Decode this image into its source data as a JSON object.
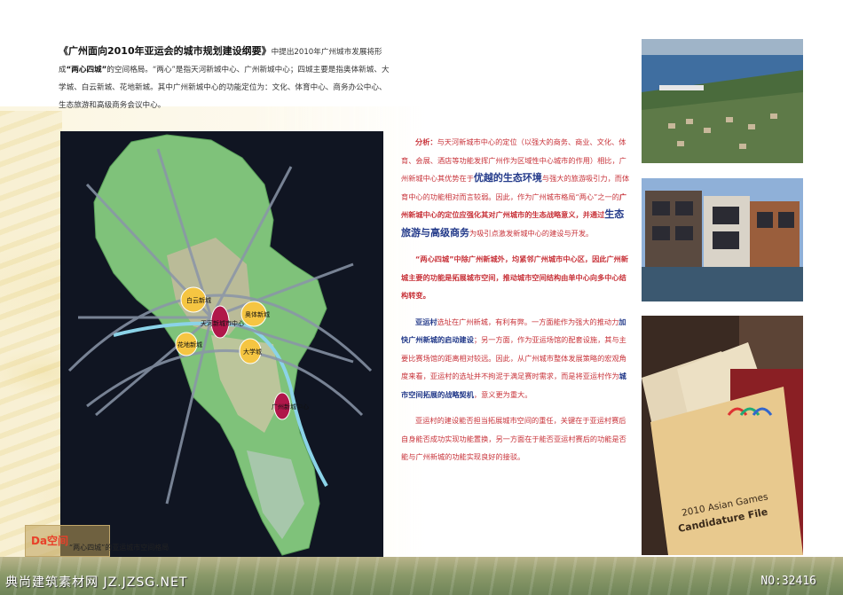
{
  "intro": {
    "title": "《广州面向2010年亚运会的城市规划建设纲要》",
    "text1": "中提出2010年广州城市发展将形成",
    "em1": "“两心四城”",
    "text2": "的空间格局。“两心”是指天河新城中心、广州新城中心；四城主要是指奥体新城、大学城、白云新城、花地新城。其中广州新城中心的功能定位为：文化、体育中心、商务办公中心、生态旅游和高级商务会议中心。"
  },
  "map": {
    "labels": {
      "baiyun": "白云新城",
      "aoti": "奥体新城",
      "tianhe": "天河新城市中心",
      "huadi": "花地新城",
      "daxue": "大学城",
      "guangzhou": "广州新城中心"
    },
    "caption": "“两心四城”的亚运城市空间格局",
    "logo": "Da空间"
  },
  "analysis": {
    "p1_label": "分析：",
    "p1_a": "与天河新城市中心的定位（以强大的商务、商业、文化、体育、会展、酒店等功能发挥广州作为区域性中心城市的作用）相比，广州新城中心其优势在于",
    "p1_big1": "优越的生态环境",
    "p1_b": "与强大的旅游吸引力，而体育中心的功能相对而言较弱。因此，作为广州城市格局“两心”之一的",
    "p1_bold": "广州新城中心的定位应强化其对广州城市的生态战略意义，并通过",
    "p1_big2": "生态旅游与高级商务",
    "p1_c": "为吸引点激发新城中心的建设与开发。",
    "p2": "“两心四城”中除广州新城外，均紧邻广州城市中心区，因此广州新城主要的功能是拓展城市空间，推动城市空间结构由单中心向多中心结构转变。",
    "p3_blue": "亚运村",
    "p3_a": "选址在广州新城，有利有弊。一方面能作为强大的推动力",
    "p3_blue2": "加快广州新城的启动建设",
    "p3_b": "；另一方面，作为亚运场馆的配套设施，其与主要比赛场馆的距离相对较远。因此，从广州城市整体发展策略的宏观角度来看，亚运村的选址并不拘泥于满足赛时需求，而是将亚运村作为",
    "p3_blue3": "城市空间拓展的战略契机",
    "p3_c": "，意义更为重大。",
    "p4": "亚运村的建设能否担当拓展城市空间的重任，关键在于亚运村赛后自身能否成功实现功能置换，另一方面在于能否亚运村赛后的功能是否能与广州新城的功能实现良好的接驳。"
  },
  "photos": {
    "bid_line1": "2010 Asian Games",
    "bid_line2": "Candidature File"
  },
  "watermark": {
    "left": "典尚建筑素材网 JZ.JZSG.NET",
    "right": "NO:32416"
  }
}
